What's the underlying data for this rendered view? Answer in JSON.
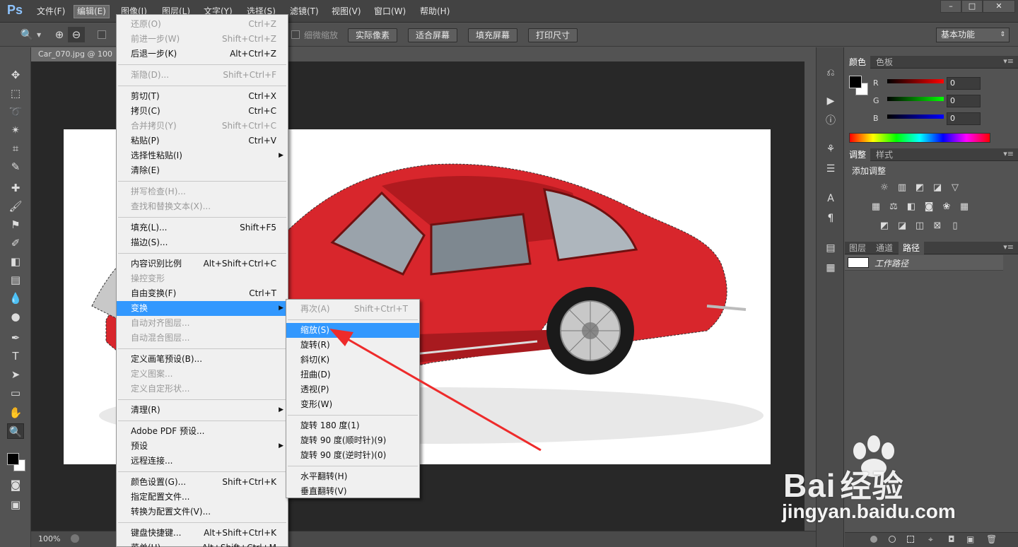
{
  "app": {
    "logo": "Ps",
    "menu": [
      "文件(F)",
      "编辑(E)",
      "图像(I)",
      "图层(L)",
      "文字(Y)",
      "选择(S)",
      "滤镜(T)",
      "视图(V)",
      "窗口(W)",
      "帮助(H)"
    ],
    "window_controls": [
      "–",
      "□",
      "✕"
    ]
  },
  "options_bar": {
    "check_label": "细微缩放",
    "buttons": [
      "实际像素",
      "适合屏幕",
      "填充屏幕",
      "打印尺寸"
    ],
    "workspace": "基本功能"
  },
  "document": {
    "tab_title": "Car_070.jpg @ 100",
    "zoom": "100%"
  },
  "edit_menu": [
    {
      "label": "还原(O)",
      "shortcut": "Ctrl+Z",
      "disabled": true
    },
    {
      "label": "前进一步(W)",
      "shortcut": "Shift+Ctrl+Z",
      "disabled": true
    },
    {
      "label": "后退一步(K)",
      "shortcut": "Alt+Ctrl+Z"
    },
    {
      "sep": true
    },
    {
      "label": "渐隐(D)...",
      "shortcut": "Shift+Ctrl+F",
      "disabled": true
    },
    {
      "sep": true
    },
    {
      "label": "剪切(T)",
      "shortcut": "Ctrl+X"
    },
    {
      "label": "拷贝(C)",
      "shortcut": "Ctrl+C"
    },
    {
      "label": "合并拷贝(Y)",
      "shortcut": "Shift+Ctrl+C",
      "disabled": true
    },
    {
      "label": "粘贴(P)",
      "shortcut": "Ctrl+V"
    },
    {
      "label": "选择性粘贴(I)",
      "submenu": true
    },
    {
      "label": "清除(E)"
    },
    {
      "sep": true
    },
    {
      "label": "拼写检查(H)...",
      "disabled": true
    },
    {
      "label": "查找和替换文本(X)...",
      "disabled": true
    },
    {
      "sep": true
    },
    {
      "label": "填充(L)...",
      "shortcut": "Shift+F5"
    },
    {
      "label": "描边(S)..."
    },
    {
      "sep": true
    },
    {
      "label": "内容识别比例",
      "shortcut": "Alt+Shift+Ctrl+C"
    },
    {
      "label": "操控变形",
      "disabled": true
    },
    {
      "label": "自由变换(F)",
      "shortcut": "Ctrl+T"
    },
    {
      "label": "变换",
      "submenu": true,
      "highlight": true
    },
    {
      "label": "自动对齐图层...",
      "disabled": true
    },
    {
      "label": "自动混合图层...",
      "disabled": true
    },
    {
      "sep": true
    },
    {
      "label": "定义画笔预设(B)..."
    },
    {
      "label": "定义图案...",
      "disabled": true
    },
    {
      "label": "定义自定形状...",
      "disabled": true
    },
    {
      "sep": true
    },
    {
      "label": "清理(R)",
      "submenu": true
    },
    {
      "sep": true
    },
    {
      "label": "Adobe PDF 预设..."
    },
    {
      "label": "预设",
      "submenu": true
    },
    {
      "label": "远程连接..."
    },
    {
      "sep": true
    },
    {
      "label": "颜色设置(G)...",
      "shortcut": "Shift+Ctrl+K"
    },
    {
      "label": "指定配置文件..."
    },
    {
      "label": "转换为配置文件(V)..."
    },
    {
      "sep": true
    },
    {
      "label": "键盘快捷键...",
      "shortcut": "Alt+Shift+Ctrl+K"
    },
    {
      "label": "菜单(U)...",
      "shortcut": "Alt+Shift+Ctrl+M"
    }
  ],
  "transform_menu": [
    {
      "label": "再次(A)",
      "shortcut": "Shift+Ctrl+T",
      "disabled": true
    },
    {
      "sep": true
    },
    {
      "label": "缩放(S)",
      "highlight": true
    },
    {
      "label": "旋转(R)"
    },
    {
      "label": "斜切(K)"
    },
    {
      "label": "扭曲(D)"
    },
    {
      "label": "透视(P)"
    },
    {
      "label": "变形(W)"
    },
    {
      "sep": true
    },
    {
      "label": "旋转 180 度(1)"
    },
    {
      "label": "旋转 90 度(顺时针)(9)"
    },
    {
      "label": "旋转 90 度(逆时针)(0)"
    },
    {
      "sep": true
    },
    {
      "label": "水平翻转(H)"
    },
    {
      "label": "垂直翻转(V)"
    }
  ],
  "color_panel": {
    "tabs": [
      "颜色",
      "色板"
    ],
    "channels": [
      {
        "name": "R",
        "value": "0",
        "color": "#ff0000"
      },
      {
        "name": "G",
        "value": "0",
        "color": "#00ff00"
      },
      {
        "name": "B",
        "value": "0",
        "color": "#0000ff"
      }
    ]
  },
  "adjust_panel": {
    "tabs": [
      "调整",
      "样式"
    ],
    "title": "添加调整"
  },
  "layers_panel": {
    "tabs": [
      "图层",
      "通道",
      "路径"
    ],
    "path_name": "工作路径"
  },
  "watermark": {
    "brand_latin": "Bai",
    "brand_cn": "经验",
    "url": "jingyan.baidu.com"
  },
  "colors": {
    "menu_highlight": "#3298fe",
    "annotation_arrow": "#ee2b2b",
    "car_red": "#d8262c"
  }
}
